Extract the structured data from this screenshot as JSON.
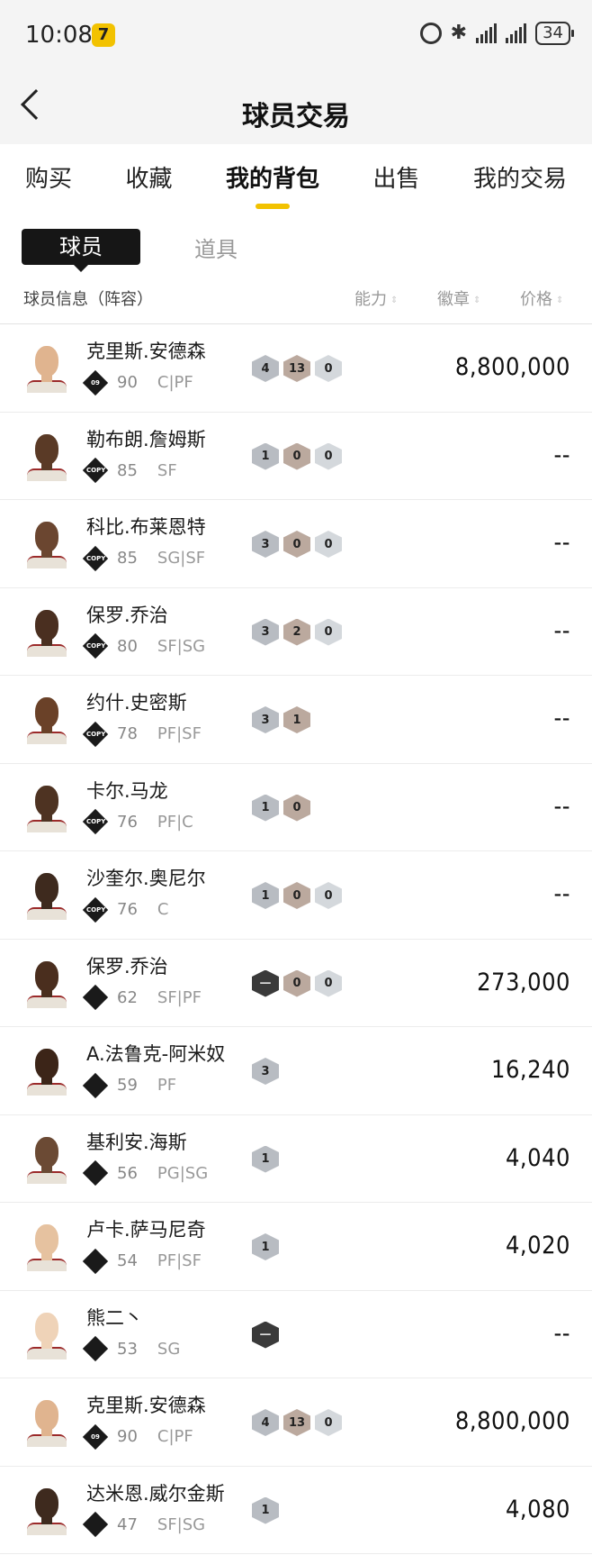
{
  "status_bar": {
    "time": "10:08",
    "battery": "34"
  },
  "header": {
    "title": "球员交易"
  },
  "tabs": [
    {
      "label": "购买",
      "active": false
    },
    {
      "label": "收藏",
      "active": false
    },
    {
      "label": "我的背包",
      "active": true
    },
    {
      "label": "出售",
      "active": false
    },
    {
      "label": "我的交易",
      "active": false
    }
  ],
  "segment": {
    "active": "球员",
    "inactive": "道具"
  },
  "columns": {
    "info": "球员信息（阵容）",
    "ability": "能力",
    "badge": "徽章",
    "price": "价格"
  },
  "players": [
    {
      "name": "克里斯.安德森",
      "tag": "09",
      "ovr": "90",
      "pos": "C|PF",
      "badges": [
        "4",
        "13",
        "0"
      ],
      "price": "8,800,000"
    },
    {
      "name": "勒布朗.詹姆斯",
      "tag": "COPY",
      "ovr": "85",
      "pos": "SF",
      "badges": [
        "1",
        "0",
        "0"
      ],
      "price": "--"
    },
    {
      "name": "科比.布莱恩特",
      "tag": "COPY",
      "ovr": "85",
      "pos": "SG|SF",
      "badges": [
        "3",
        "0",
        "0"
      ],
      "price": "--"
    },
    {
      "name": "保罗.乔治",
      "tag": "COPY",
      "ovr": "80",
      "pos": "SF|SG",
      "badges": [
        "3",
        "2",
        "0"
      ],
      "price": "--"
    },
    {
      "name": "约什.史密斯",
      "tag": "COPY",
      "ovr": "78",
      "pos": "PF|SF",
      "badges": [
        "3",
        "1"
      ],
      "price": "--"
    },
    {
      "name": "卡尔.马龙",
      "tag": "COPY",
      "ovr": "76",
      "pos": "PF|C",
      "badges": [
        "1",
        "0"
      ],
      "price": "--"
    },
    {
      "name": "沙奎尔.奥尼尔",
      "tag": "COPY",
      "ovr": "76",
      "pos": "C",
      "badges": [
        "1",
        "0",
        "0"
      ],
      "price": "--"
    },
    {
      "name": "保罗.乔治",
      "tag": "",
      "ovr": "62",
      "pos": "SF|PF",
      "badges": [
        "—",
        "0",
        "0"
      ],
      "price": "273,000"
    },
    {
      "name": "A.法鲁克-阿米奴",
      "tag": "",
      "ovr": "59",
      "pos": "PF",
      "badges": [
        "3"
      ],
      "price": "16,240"
    },
    {
      "name": "基利安.海斯",
      "tag": "",
      "ovr": "56",
      "pos": "PG|SG",
      "badges": [
        "1"
      ],
      "price": "4,040"
    },
    {
      "name": "卢卡.萨马尼奇",
      "tag": "",
      "ovr": "54",
      "pos": "PF|SF",
      "badges": [
        "1"
      ],
      "price": "4,020"
    },
    {
      "name": "熊二丶",
      "tag": "",
      "ovr": "53",
      "pos": "SG",
      "badges": [
        "—"
      ],
      "price": "--"
    },
    {
      "name": "克里斯.安德森",
      "tag": "09",
      "ovr": "90",
      "pos": "C|PF",
      "badges": [
        "4",
        "13",
        "0"
      ],
      "price": "8,800,000"
    },
    {
      "name": "达米恩.威尔金斯",
      "tag": "",
      "ovr": "47",
      "pos": "SF|SG",
      "badges": [
        "1"
      ],
      "price": "4,080"
    }
  ]
}
